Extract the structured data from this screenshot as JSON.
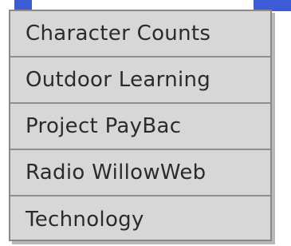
{
  "menu": {
    "items": [
      {
        "label": "Character Counts"
      },
      {
        "label": "Outdoor Learning"
      },
      {
        "label": "Project PayBac"
      },
      {
        "label": "Radio WillowWeb"
      },
      {
        "label": "Technology"
      }
    ]
  },
  "colors": {
    "menu_background": "#d7d7d7",
    "menu_border": "#8a8a8a",
    "accent_bar": "#3d5bd6",
    "text": "#2b2b2b"
  }
}
